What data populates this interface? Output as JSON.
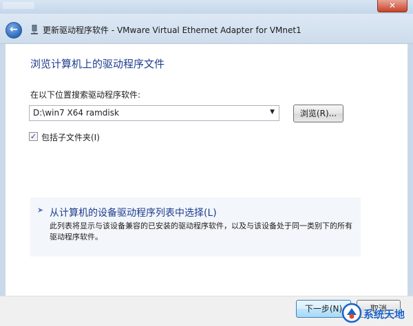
{
  "window": {
    "title": "更新驱动程序软件 - VMware Virtual Ethernet Adapter for VMnet1",
    "close_label": "✕"
  },
  "main": {
    "heading": "浏览计算机上的驱动程序文件",
    "search_label": "在以下位置搜索驱动程序软件:",
    "path_value": "D:\\win7 X64 ramdisk",
    "browse_label": "浏览(R)...",
    "include_subfolders_label": "包括子文件夹(I)",
    "include_subfolders_checked": true
  },
  "pick_option": {
    "title": "从计算机的设备驱动程序列表中选择(L)",
    "description": "此列表将显示与该设备兼容的已安装的驱动程序软件，以及与该设备处于同一类别下的所有驱动程序软件。"
  },
  "footer": {
    "next_label": "下一步(N)",
    "cancel_label": "取消"
  },
  "watermark": {
    "text": "系统天地"
  },
  "icons": {
    "back": "back-arrow-icon",
    "device": "network-adapter-icon",
    "pick_arrow": "arrow-right-icon",
    "check": "checkmark-icon"
  },
  "colors": {
    "heading_blue": "#1d3d8f",
    "frame_blue": "#c9d9ea",
    "close_red": "#c7432a"
  }
}
